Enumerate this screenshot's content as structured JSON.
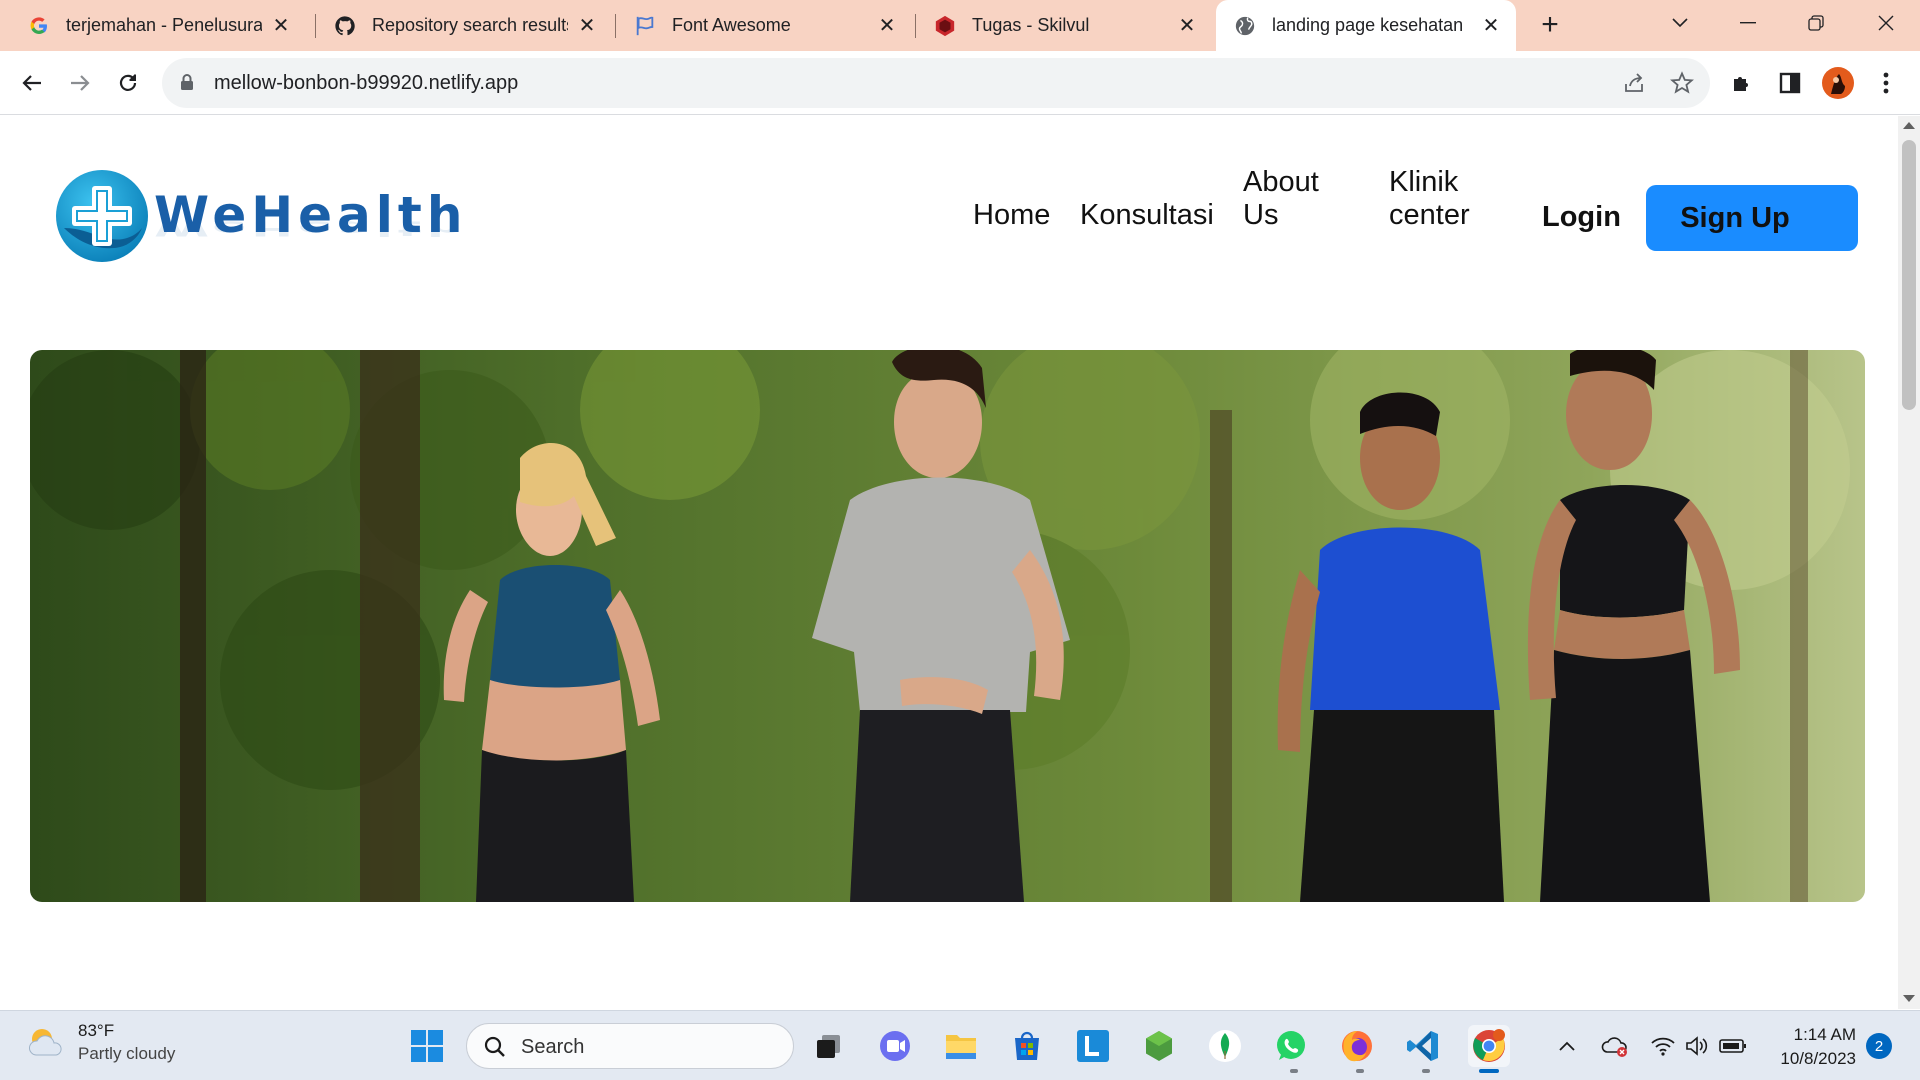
{
  "browser": {
    "tabs": [
      {
        "title": "terjemahan - Penelusuran",
        "favicon": "google-icon"
      },
      {
        "title": "Repository search results",
        "favicon": "github-icon"
      },
      {
        "title": "Font Awesome",
        "favicon": "font-awesome-flag-icon"
      },
      {
        "title": "Tugas - Skilvul",
        "favicon": "skilvul-icon"
      },
      {
        "title": "landing page kesehatan",
        "favicon": "globe-icon",
        "active": true
      }
    ],
    "url": "mellow-bonbon-b99920.netlify.app"
  },
  "site": {
    "logo_text": "WeHealth",
    "nav": {
      "home": "Home",
      "konsultasi": "Konsultasi",
      "about_line1": "About",
      "about_line2": "Us",
      "klinik_line1": "Klinik",
      "klinik_line2": "center"
    },
    "login": "Login",
    "signup": "Sign Up",
    "colors": {
      "brand": "#1a5fa8",
      "signup_bg": "#1a8cff",
      "logo_circle": "#1aa0d6"
    }
  },
  "taskbar": {
    "weather_temp": "83°F",
    "weather_cond": "Partly cloudy",
    "search_placeholder": "Search",
    "time": "1:14 AM",
    "date": "10/8/2023",
    "notification_count": "2"
  }
}
